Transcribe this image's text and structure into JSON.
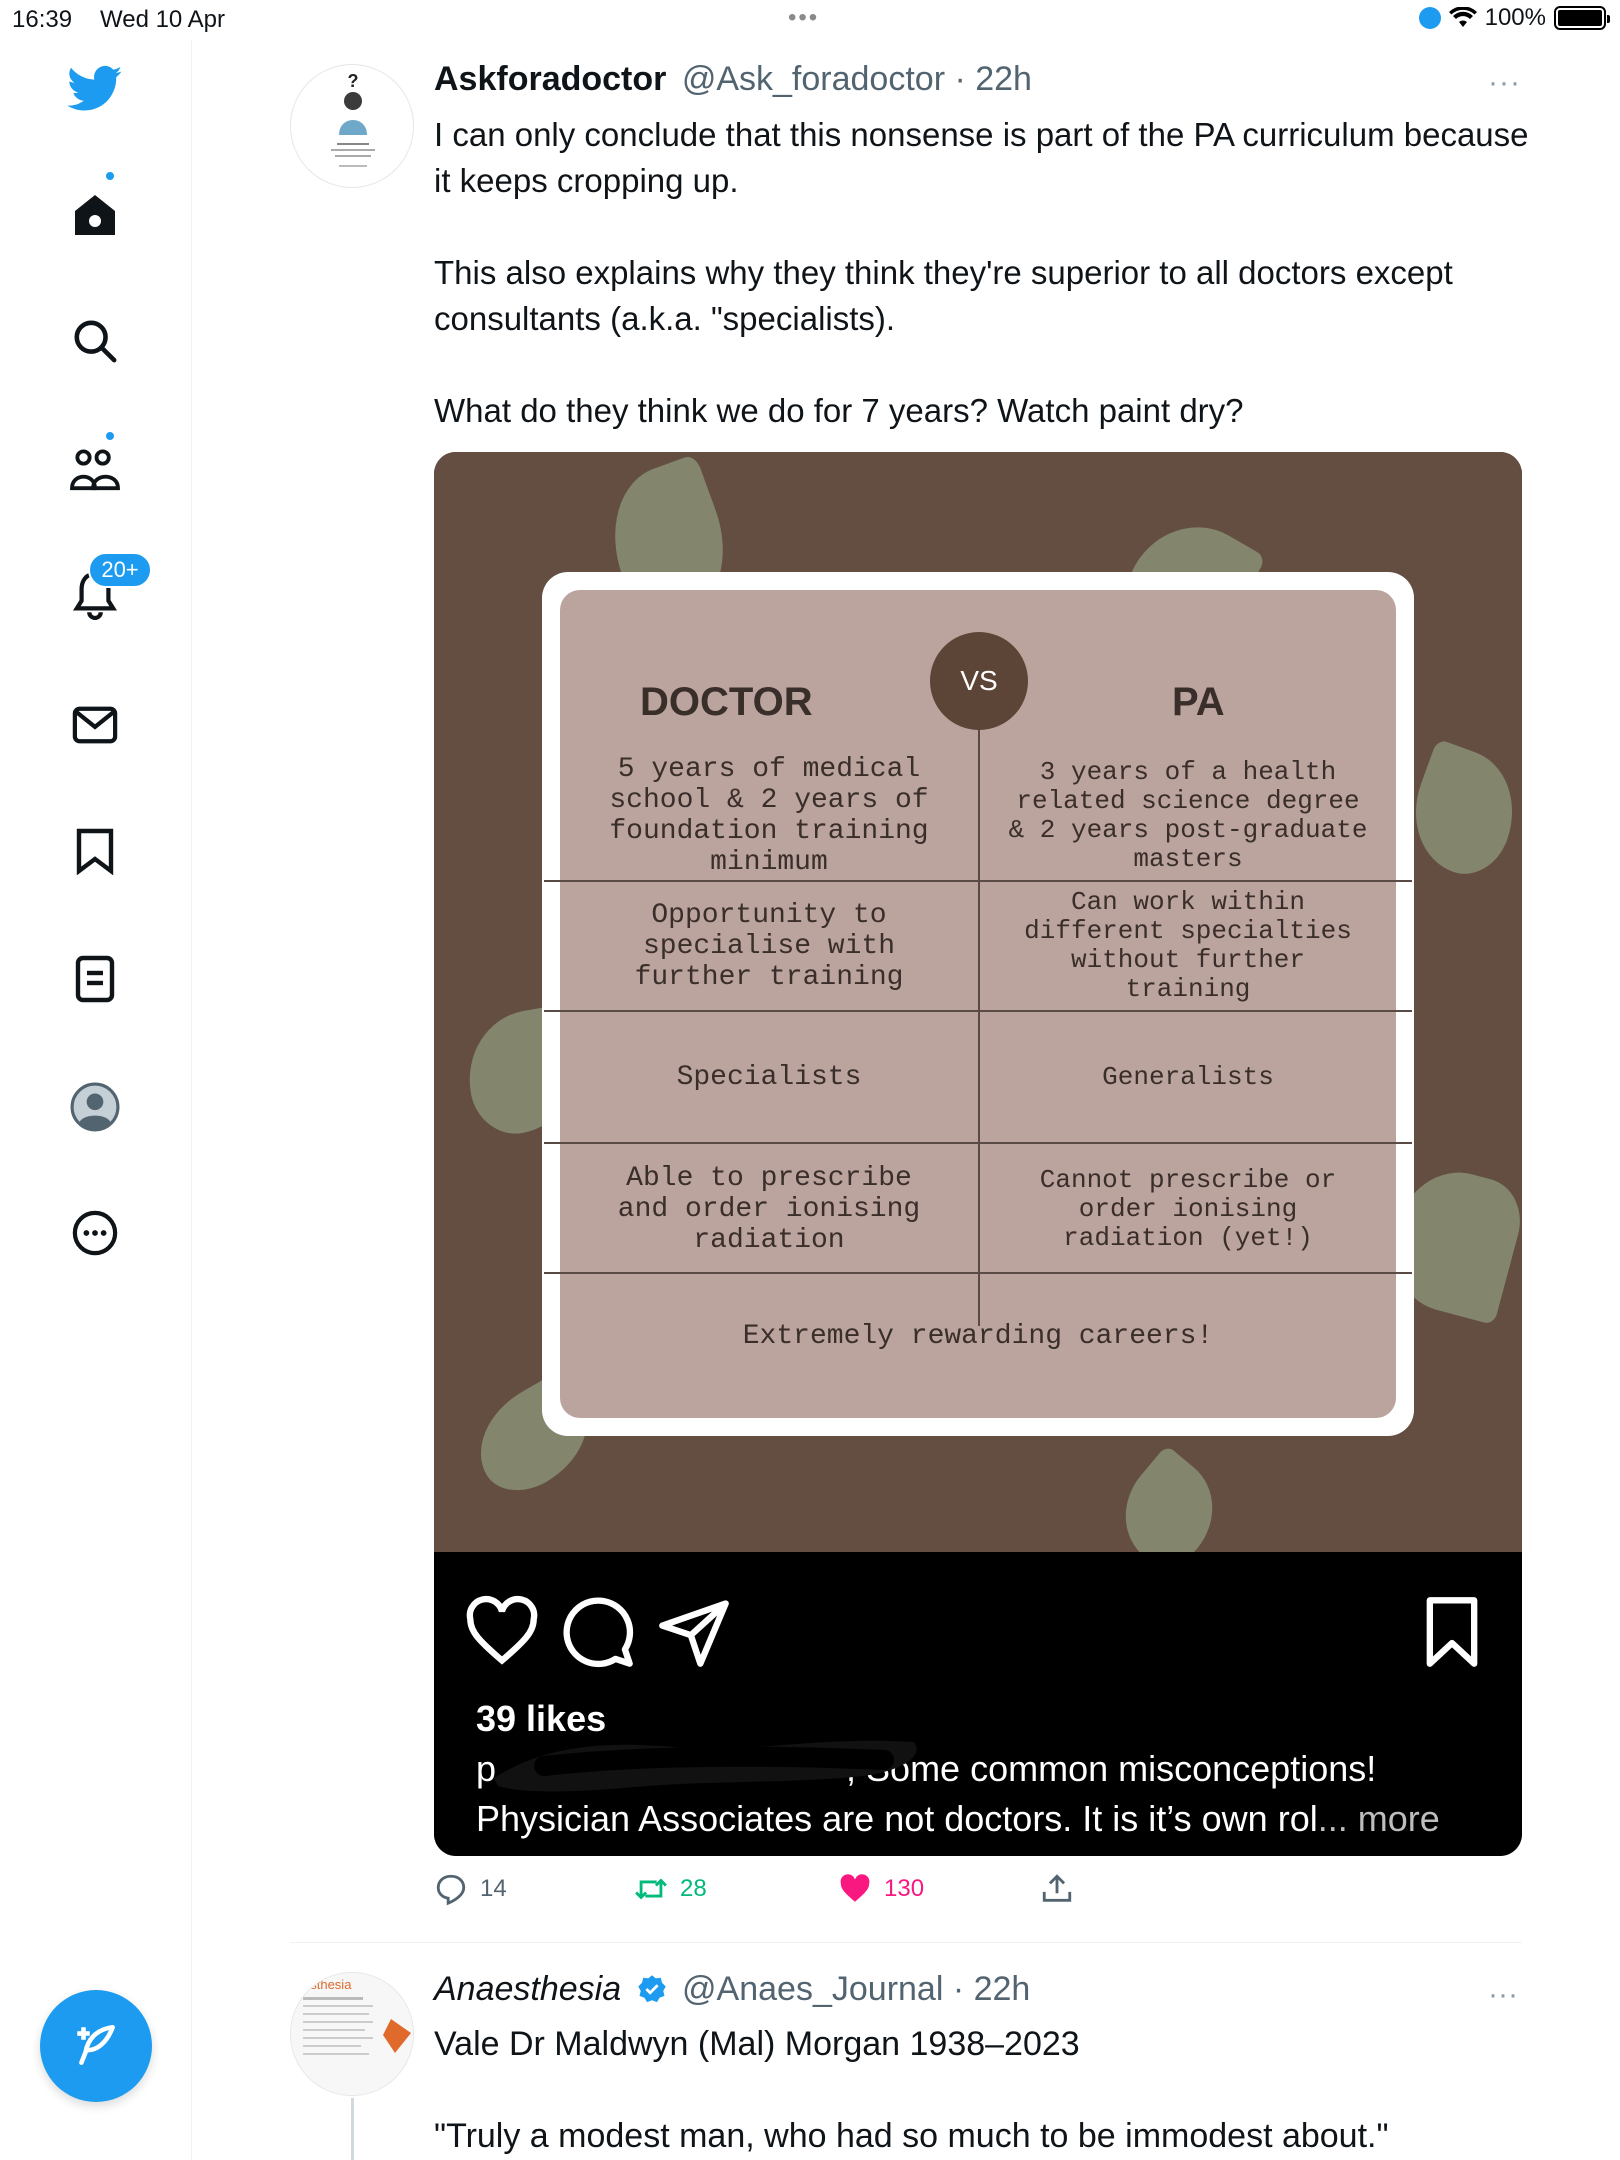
{
  "status_bar": {
    "time": "16:39",
    "date": "Wed 10 Apr",
    "battery": "100%",
    "battery_level": 1.0
  },
  "sidebar": {
    "items": [
      {
        "name": "twitter-logo-icon"
      },
      {
        "name": "home-icon",
        "has_dot": true
      },
      {
        "name": "search-icon"
      },
      {
        "name": "communities-icon",
        "has_dot": true
      },
      {
        "name": "notifications-icon",
        "badge": "20+"
      },
      {
        "name": "messages-icon"
      },
      {
        "name": "bookmarks-icon"
      },
      {
        "name": "lists-icon"
      },
      {
        "name": "profile-icon"
      },
      {
        "name": "more-icon"
      }
    ],
    "compose_icon": "compose-icon"
  },
  "tweet1": {
    "name": "Askforadoctor",
    "handle": "@Ask_foradoctor",
    "time": "· 22h",
    "more": "···",
    "avatar_mark": "?",
    "text": [
      "I can only conclude that this nonsense is part of the PA curriculum because it keeps cropping up.",
      "This also explains why they think they're superior to all doctors except consultants (a.k.a. \"specialists).",
      "What do they think we do for 7 years? Watch paint dry?"
    ],
    "media": {
      "left_title": "DOCTOR",
      "vs": "VS",
      "right_title": "PA",
      "rows": [
        {
          "left": "5 years of medical\nschool & 2 years of\nfoundation training\nminimum",
          "right": "3 years of a health\nrelated science degree\n& 2 years post-graduate\nmasters"
        },
        {
          "left": "Opportunity to\nspecialise with\nfurther training",
          "right": "Can work within\ndifferent specialties\nwithout further\ntraining"
        },
        {
          "left": "Specialists",
          "right": "Generalists"
        },
        {
          "left": "Able to prescribe\nand order ionising\nradiation",
          "right": "Cannot prescribe or\norder ionising\nradiation (yet!)"
        }
      ],
      "footer": "Extremely rewarding careers!",
      "ig_likes": "39 likes",
      "ig_caption_1": ", Some common misconceptions!",
      "ig_caption_1_prefix": "p",
      "ig_caption_2": "Physician Associates are not doctors. It is it’s own rol",
      "ig_caption_more": "... more"
    },
    "actions": {
      "replies": "14",
      "retweets": "28",
      "likes": "130"
    }
  },
  "tweet2": {
    "name": "Anaesthesia",
    "handle": "@Anaes_Journal",
    "time": "· 22h",
    "more": "···",
    "avatar_text": "esthesia",
    "text": [
      "Vale Dr Maldwyn (Mal) Morgan 1938–2023",
      "\"Truly a modest man, who had so much to be immodest about.\""
    ]
  },
  "colors": {
    "accent": "#1d9bf0",
    "retweet": "#00ba7c",
    "like": "#f91880",
    "poster_bg": "#644e41",
    "card_fill": "#bba39e"
  }
}
